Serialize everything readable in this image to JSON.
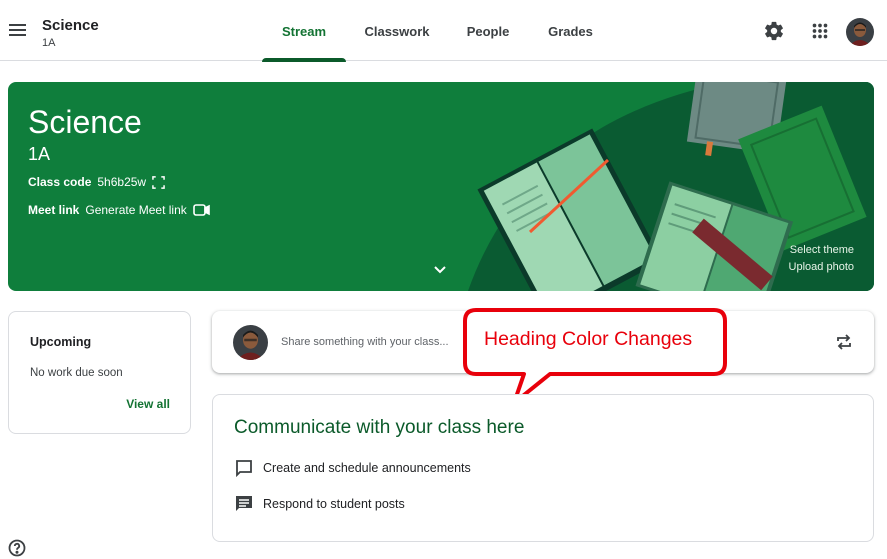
{
  "header": {
    "class_name": "Science",
    "section": "1A",
    "tabs": [
      {
        "label": "Stream",
        "active": true
      },
      {
        "label": "Classwork",
        "active": false
      },
      {
        "label": "People",
        "active": false
      },
      {
        "label": "Grades",
        "active": false
      }
    ],
    "icons": [
      "menu-icon",
      "gear-icon",
      "apps-grid-icon",
      "avatar"
    ]
  },
  "banner": {
    "title": "Science",
    "section": "1A",
    "class_code_label": "Class code",
    "class_code": "5h6b25w",
    "meet_label": "Meet link",
    "meet_value": "Generate Meet link",
    "select_theme": "Select theme",
    "upload_photo": "Upload photo",
    "colors": {
      "primary": "#0f7e3c",
      "dark": "#0b5a2a"
    }
  },
  "upcoming": {
    "title": "Upcoming",
    "text": "No work due soon",
    "link": "View all"
  },
  "share": {
    "placeholder": "Share something with your class..."
  },
  "callout": {
    "text": "Heading Color Changes",
    "color": "#e8000b"
  },
  "communicate": {
    "heading": "Communicate with your class here",
    "items": [
      {
        "icon": "announcement-icon",
        "label": "Create and schedule announcements"
      },
      {
        "icon": "comment-icon",
        "label": "Respond to student posts"
      }
    ]
  }
}
